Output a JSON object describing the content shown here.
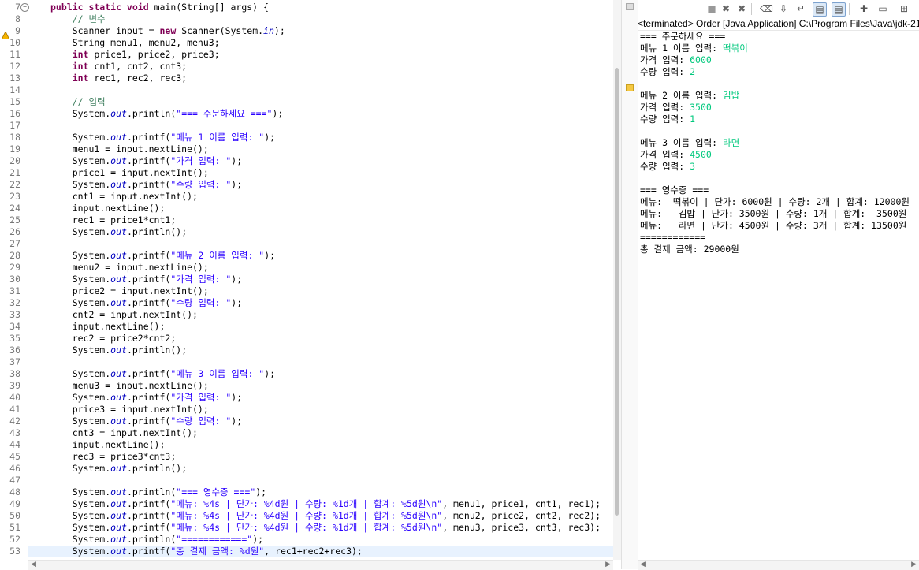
{
  "editor": {
    "first_line": 7,
    "current_line": 53,
    "warning_line": 9,
    "fold_line": 7,
    "lines": [
      [
        [
          "kw",
          "public static void "
        ],
        [
          "t",
          "main(String[] args) {"
        ]
      ],
      [
        [
          "t",
          "    "
        ],
        [
          "cm",
          "// 변수"
        ]
      ],
      [
        [
          "t",
          "    Scanner input = "
        ],
        [
          "kw",
          "new "
        ],
        [
          "t",
          "Scanner(System."
        ],
        [
          "fld",
          "in"
        ],
        [
          "t",
          ");"
        ]
      ],
      [
        [
          "t",
          "    String menu1, menu2, menu3;"
        ]
      ],
      [
        [
          "t",
          "    "
        ],
        [
          "kw",
          "int "
        ],
        [
          "t",
          "price1, price2, price3;"
        ]
      ],
      [
        [
          "t",
          "    "
        ],
        [
          "kw",
          "int "
        ],
        [
          "t",
          "cnt1, cnt2, cnt3;"
        ]
      ],
      [
        [
          "t",
          "    "
        ],
        [
          "kw",
          "int "
        ],
        [
          "t",
          "rec1, rec2, rec3;"
        ]
      ],
      [],
      [
        [
          "t",
          "    "
        ],
        [
          "cm",
          "// 입력"
        ]
      ],
      [
        [
          "t",
          "    System."
        ],
        [
          "fld",
          "out"
        ],
        [
          "t",
          ".println("
        ],
        [
          "str",
          "\"=== 주문하세요 ===\""
        ],
        [
          "t",
          ");"
        ]
      ],
      [],
      [
        [
          "t",
          "    System."
        ],
        [
          "fld",
          "out"
        ],
        [
          "t",
          ".printf("
        ],
        [
          "str",
          "\"메뉴 1 이름 입력: \""
        ],
        [
          "t",
          ");"
        ]
      ],
      [
        [
          "t",
          "    menu1 = input.nextLine();"
        ]
      ],
      [
        [
          "t",
          "    System."
        ],
        [
          "fld",
          "out"
        ],
        [
          "t",
          ".printf("
        ],
        [
          "str",
          "\"가격 입력: \""
        ],
        [
          "t",
          ");"
        ]
      ],
      [
        [
          "t",
          "    price1 = input.nextInt();"
        ]
      ],
      [
        [
          "t",
          "    System."
        ],
        [
          "fld",
          "out"
        ],
        [
          "t",
          ".printf("
        ],
        [
          "str",
          "\"수량 입력: \""
        ],
        [
          "t",
          ");"
        ]
      ],
      [
        [
          "t",
          "    cnt1 = input.nextInt();"
        ]
      ],
      [
        [
          "t",
          "    input.nextLine();"
        ]
      ],
      [
        [
          "t",
          "    rec1 = price1*cnt1;"
        ]
      ],
      [
        [
          "t",
          "    System."
        ],
        [
          "fld",
          "out"
        ],
        [
          "t",
          ".println();"
        ]
      ],
      [],
      [
        [
          "t",
          "    System."
        ],
        [
          "fld",
          "out"
        ],
        [
          "t",
          ".printf("
        ],
        [
          "str",
          "\"메뉴 2 이름 입력: \""
        ],
        [
          "t",
          ");"
        ]
      ],
      [
        [
          "t",
          "    menu2 = input.nextLine();"
        ]
      ],
      [
        [
          "t",
          "    System."
        ],
        [
          "fld",
          "out"
        ],
        [
          "t",
          ".printf("
        ],
        [
          "str",
          "\"가격 입력: \""
        ],
        [
          "t",
          ");"
        ]
      ],
      [
        [
          "t",
          "    price2 = input.nextInt();"
        ]
      ],
      [
        [
          "t",
          "    System."
        ],
        [
          "fld",
          "out"
        ],
        [
          "t",
          ".printf("
        ],
        [
          "str",
          "\"수량 입력: \""
        ],
        [
          "t",
          ");"
        ]
      ],
      [
        [
          "t",
          "    cnt2 = input.nextInt();"
        ]
      ],
      [
        [
          "t",
          "    input.nextLine();"
        ]
      ],
      [
        [
          "t",
          "    rec2 = price2*cnt2;"
        ]
      ],
      [
        [
          "t",
          "    System."
        ],
        [
          "fld",
          "out"
        ],
        [
          "t",
          ".println();"
        ]
      ],
      [],
      [
        [
          "t",
          "    System."
        ],
        [
          "fld",
          "out"
        ],
        [
          "t",
          ".printf("
        ],
        [
          "str",
          "\"메뉴 3 이름 입력: \""
        ],
        [
          "t",
          ");"
        ]
      ],
      [
        [
          "t",
          "    menu3 = input.nextLine();"
        ]
      ],
      [
        [
          "t",
          "    System."
        ],
        [
          "fld",
          "out"
        ],
        [
          "t",
          ".printf("
        ],
        [
          "str",
          "\"가격 입력: \""
        ],
        [
          "t",
          ");"
        ]
      ],
      [
        [
          "t",
          "    price3 = input.nextInt();"
        ]
      ],
      [
        [
          "t",
          "    System."
        ],
        [
          "fld",
          "out"
        ],
        [
          "t",
          ".printf("
        ],
        [
          "str",
          "\"수량 입력: \""
        ],
        [
          "t",
          ");"
        ]
      ],
      [
        [
          "t",
          "    cnt3 = input.nextInt();"
        ]
      ],
      [
        [
          "t",
          "    input.nextLine();"
        ]
      ],
      [
        [
          "t",
          "    rec3 = price3*cnt3;"
        ]
      ],
      [
        [
          "t",
          "    System."
        ],
        [
          "fld",
          "out"
        ],
        [
          "t",
          ".println();"
        ]
      ],
      [],
      [
        [
          "t",
          "    System."
        ],
        [
          "fld",
          "out"
        ],
        [
          "t",
          ".println("
        ],
        [
          "str",
          "\"=== 영수증 ===\""
        ],
        [
          "t",
          ");"
        ]
      ],
      [
        [
          "t",
          "    System."
        ],
        [
          "fld",
          "out"
        ],
        [
          "t",
          ".printf("
        ],
        [
          "str",
          "\"메뉴: %4s | 단가: %4d원 | 수량: %1d개 | 합계: %5d원\\n\""
        ],
        [
          "t",
          ", menu1, price1, cnt1, rec1);"
        ]
      ],
      [
        [
          "t",
          "    System."
        ],
        [
          "fld",
          "out"
        ],
        [
          "t",
          ".printf("
        ],
        [
          "str",
          "\"메뉴: %4s | 단가: %4d원 | 수량: %1d개 | 합계: %5d원\\n\""
        ],
        [
          "t",
          ", menu2, price2, cnt2, rec2);"
        ]
      ],
      [
        [
          "t",
          "    System."
        ],
        [
          "fld",
          "out"
        ],
        [
          "t",
          ".printf("
        ],
        [
          "str",
          "\"메뉴: %4s | 단가: %4d원 | 수량: %1d개 | 합계: %5d원\\n\""
        ],
        [
          "t",
          ", menu3, price3, cnt3, rec3);"
        ]
      ],
      [
        [
          "t",
          "    System."
        ],
        [
          "fld",
          "out"
        ],
        [
          "t",
          ".println("
        ],
        [
          "str",
          "\"============\""
        ],
        [
          "t",
          ");"
        ]
      ],
      [
        [
          "t",
          "    System."
        ],
        [
          "fld",
          "out"
        ],
        [
          "t",
          ".printf("
        ],
        [
          "str",
          "\"총 결제 금액: %d원\""
        ],
        [
          "t",
          ", rec1+rec2+rec3);"
        ]
      ]
    ]
  },
  "console": {
    "header": "<terminated> Order [Java Application] C:\\Program Files\\Java\\jdk-21",
    "toolbar_icons": [
      "terminate-icon",
      "remove-launch-icon",
      "remove-all-launches-icon",
      "clear-console-icon",
      "scroll-lock-icon",
      "word-wrap-icon",
      "show-on-stdout-icon",
      "show-on-stderr-icon",
      "pin-console-icon",
      "display-console-icon",
      "open-console-icon"
    ],
    "output": [
      [
        [
          "out",
          "=== 주문하세요 ==="
        ]
      ],
      [
        [
          "out",
          "메뉴 1 이름 입력: "
        ],
        [
          "in",
          "떡볶이"
        ]
      ],
      [
        [
          "out",
          "가격 입력: "
        ],
        [
          "in",
          "6000"
        ]
      ],
      [
        [
          "out",
          "수량 입력: "
        ],
        [
          "in",
          "2"
        ]
      ],
      [],
      [
        [
          "out",
          "메뉴 2 이름 입력: "
        ],
        [
          "in",
          "김밥"
        ]
      ],
      [
        [
          "out",
          "가격 입력: "
        ],
        [
          "in",
          "3500"
        ]
      ],
      [
        [
          "out",
          "수량 입력: "
        ],
        [
          "in",
          "1"
        ]
      ],
      [],
      [
        [
          "out",
          "메뉴 3 이름 입력: "
        ],
        [
          "in",
          "라면"
        ]
      ],
      [
        [
          "out",
          "가격 입력: "
        ],
        [
          "in",
          "4500"
        ]
      ],
      [
        [
          "out",
          "수량 입력: "
        ],
        [
          "in",
          "3"
        ]
      ],
      [],
      [
        [
          "out",
          "=== 영수증 ==="
        ]
      ],
      [
        [
          "out",
          "메뉴:  떡볶이 | 단가: 6000원 | 수량: 2개 | 합계: 12000원"
        ]
      ],
      [
        [
          "out",
          "메뉴:   김밥 | 단가: 3500원 | 수량: 1개 | 합계:  3500원"
        ]
      ],
      [
        [
          "out",
          "메뉴:   라면 | 단가: 4500원 | 수량: 3개 | 합계: 13500원"
        ]
      ],
      [
        [
          "out",
          "============"
        ]
      ],
      [
        [
          "out",
          "총 결제 금액: 29000원"
        ]
      ]
    ]
  }
}
